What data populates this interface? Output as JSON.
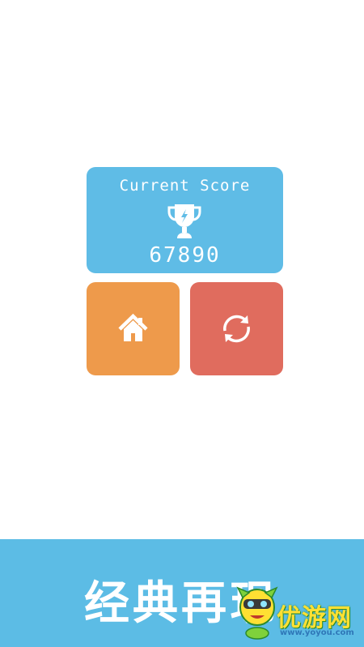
{
  "score_card": {
    "label": "Current Score",
    "value": "67890",
    "icon": "trophy-icon"
  },
  "buttons": {
    "home": {
      "icon": "home-icon"
    },
    "restart": {
      "icon": "restart-icon"
    }
  },
  "banner": {
    "text": "经典再现"
  },
  "watermark": {
    "logo_text": "优游网",
    "url": "www.yoyou.com"
  },
  "colors": {
    "score_card": "#5fbce6",
    "home_button": "#ee9a4b",
    "restart_button": "#e06c5e",
    "banner": "#5cbce5"
  }
}
